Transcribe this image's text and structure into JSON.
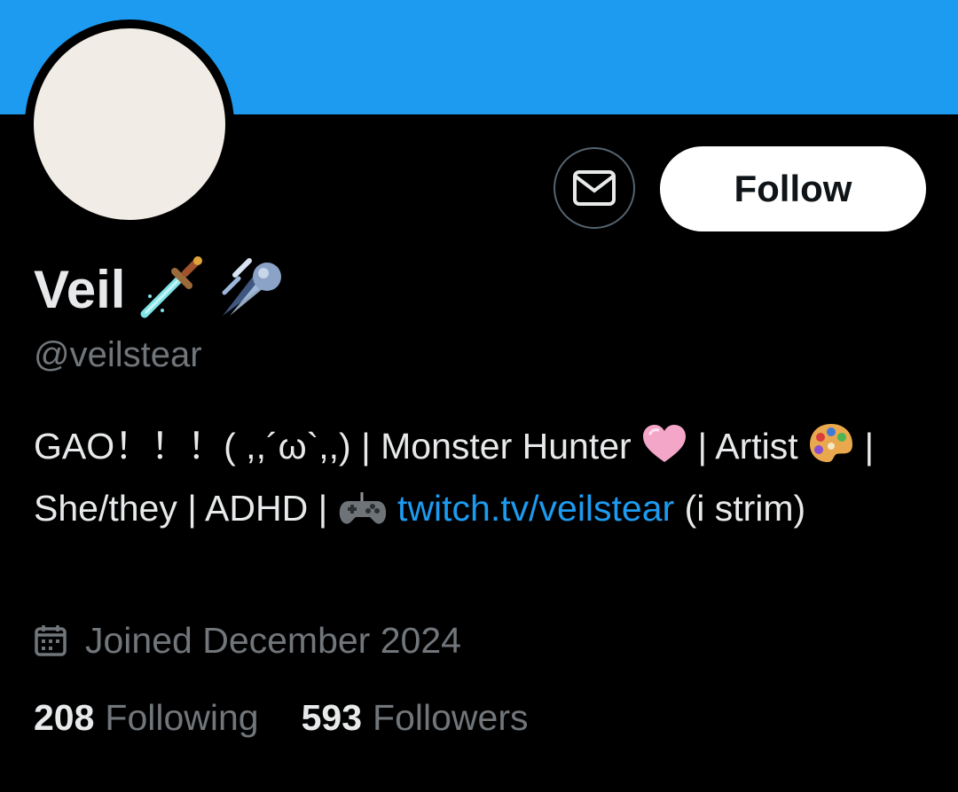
{
  "profile": {
    "display_name": "Veil",
    "handle": "@veilstear",
    "bio_part1": "GAO！！！( ,,´ω`,,) | Monster Hunter",
    "bio_part2": " | Artist",
    "bio_part3": " | She/they | ADHD |",
    "bio_link": "twitch.tv/veilstear",
    "bio_part4": " (i strim)",
    "joined": "Joined December 2024",
    "following_count": "208",
    "following_label": "Following",
    "followers_count": "593",
    "followers_label": "Followers"
  },
  "actions": {
    "follow_label": "Follow"
  },
  "icons": {
    "name_emoji_1": "sword-emoji",
    "name_emoji_2": "comet-emoji",
    "heart": "pink-heart-emoji",
    "palette": "artist-palette-emoji",
    "gamepad": "video-game-controller-emoji",
    "message": "envelope-icon",
    "calendar": "calendar-icon"
  },
  "colors": {
    "banner": "#1d9bf0",
    "link": "#1d9bf0",
    "avatar": "#f1ede6",
    "background": "#000000"
  }
}
